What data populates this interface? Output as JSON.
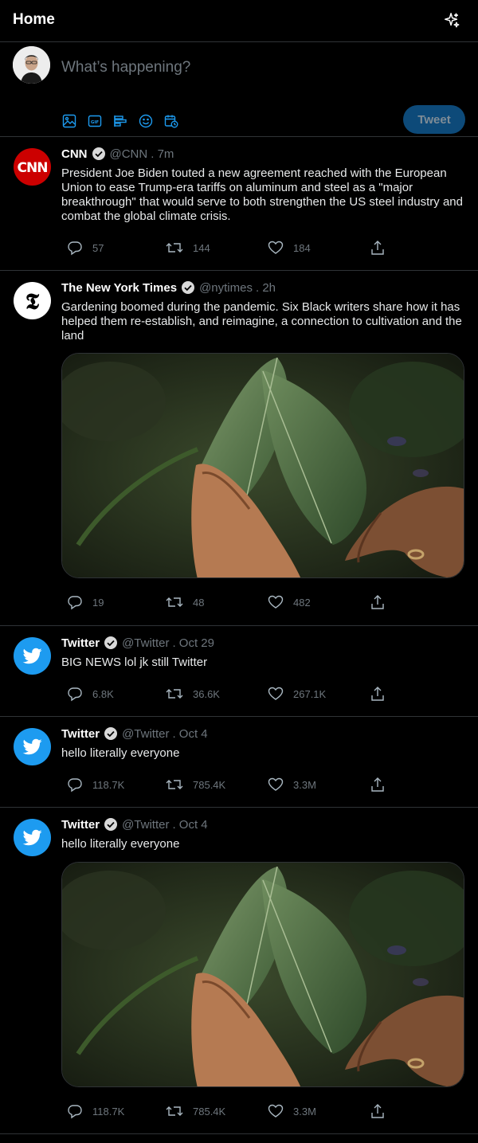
{
  "header": {
    "title": "Home"
  },
  "composer": {
    "placeholder": "What’s happening?",
    "tweet_label": "Tweet"
  },
  "tweets": [
    {
      "name": "CNN",
      "handle": "@CNN",
      "time": ". 7m",
      "text": "President Joe Biden touted a new agreement reached with the European Union to ease Trump-era tariffs on aluminum and steel as a \"major breakthrough\" that would serve to both strengthen the US steel industry and combat the global climate crisis.",
      "avatar_text": "CNN",
      "replies": "57",
      "retweets": "144",
      "likes": "184"
    },
    {
      "name": "The New York Times",
      "handle": "@nytimes",
      "time": ". 2h",
      "text": "Gardening boomed during the pandemic. Six Black writers share how it has helped them re-establish, and reimagine, a connection to cultivation and the land",
      "avatar_text": "𝕿",
      "replies": "19",
      "retweets": "48",
      "likes": "482"
    },
    {
      "name": "Twitter",
      "handle": "@Twitter",
      "time": ". Oct 29",
      "text": "BIG NEWS lol jk still Twitter",
      "replies": "6.8K",
      "retweets": "36.6K",
      "likes": "267.1K"
    },
    {
      "name": "Twitter",
      "handle": "@Twitter",
      "time": ". Oct 4",
      "text": "hello literally everyone",
      "replies": "118.7K",
      "retweets": "785.4K",
      "likes": "3.3M"
    },
    {
      "name": "Twitter",
      "handle": "@Twitter",
      "time": ". Oct 4",
      "text": "hello literally everyone",
      "replies": "118.7K",
      "retweets": "785.4K",
      "likes": "3.3M"
    }
  ],
  "colors": {
    "accent": "#1d9bf0",
    "background": "#000000",
    "cnn_red": "#cc0000",
    "twitter_blue": "#1d9bf0"
  }
}
